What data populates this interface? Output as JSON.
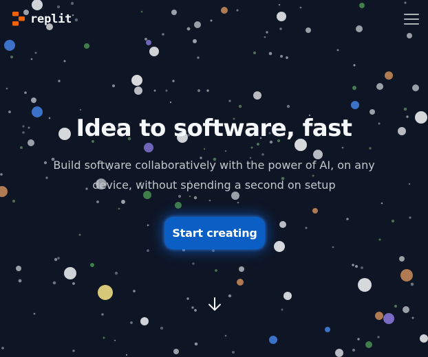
{
  "header": {
    "logo_text": "replit",
    "logo_icon": "replit-logo-icon",
    "menu_icon": "hamburger-menu-icon"
  },
  "hero": {
    "title": "Idea to software, fast",
    "subtitle": "Build software collaboratively with the power of AI, on any device, without spending a second on setup"
  },
  "cta": {
    "label": "Start creating"
  },
  "scroll": {
    "icon": "arrow-down-icon"
  },
  "colors": {
    "background": "#0e1525",
    "brand_orange": "#f26207",
    "cta_blue": "#0b5ec4",
    "text_primary": "#f5f9fc",
    "text_secondary": "#c2c8cc"
  }
}
